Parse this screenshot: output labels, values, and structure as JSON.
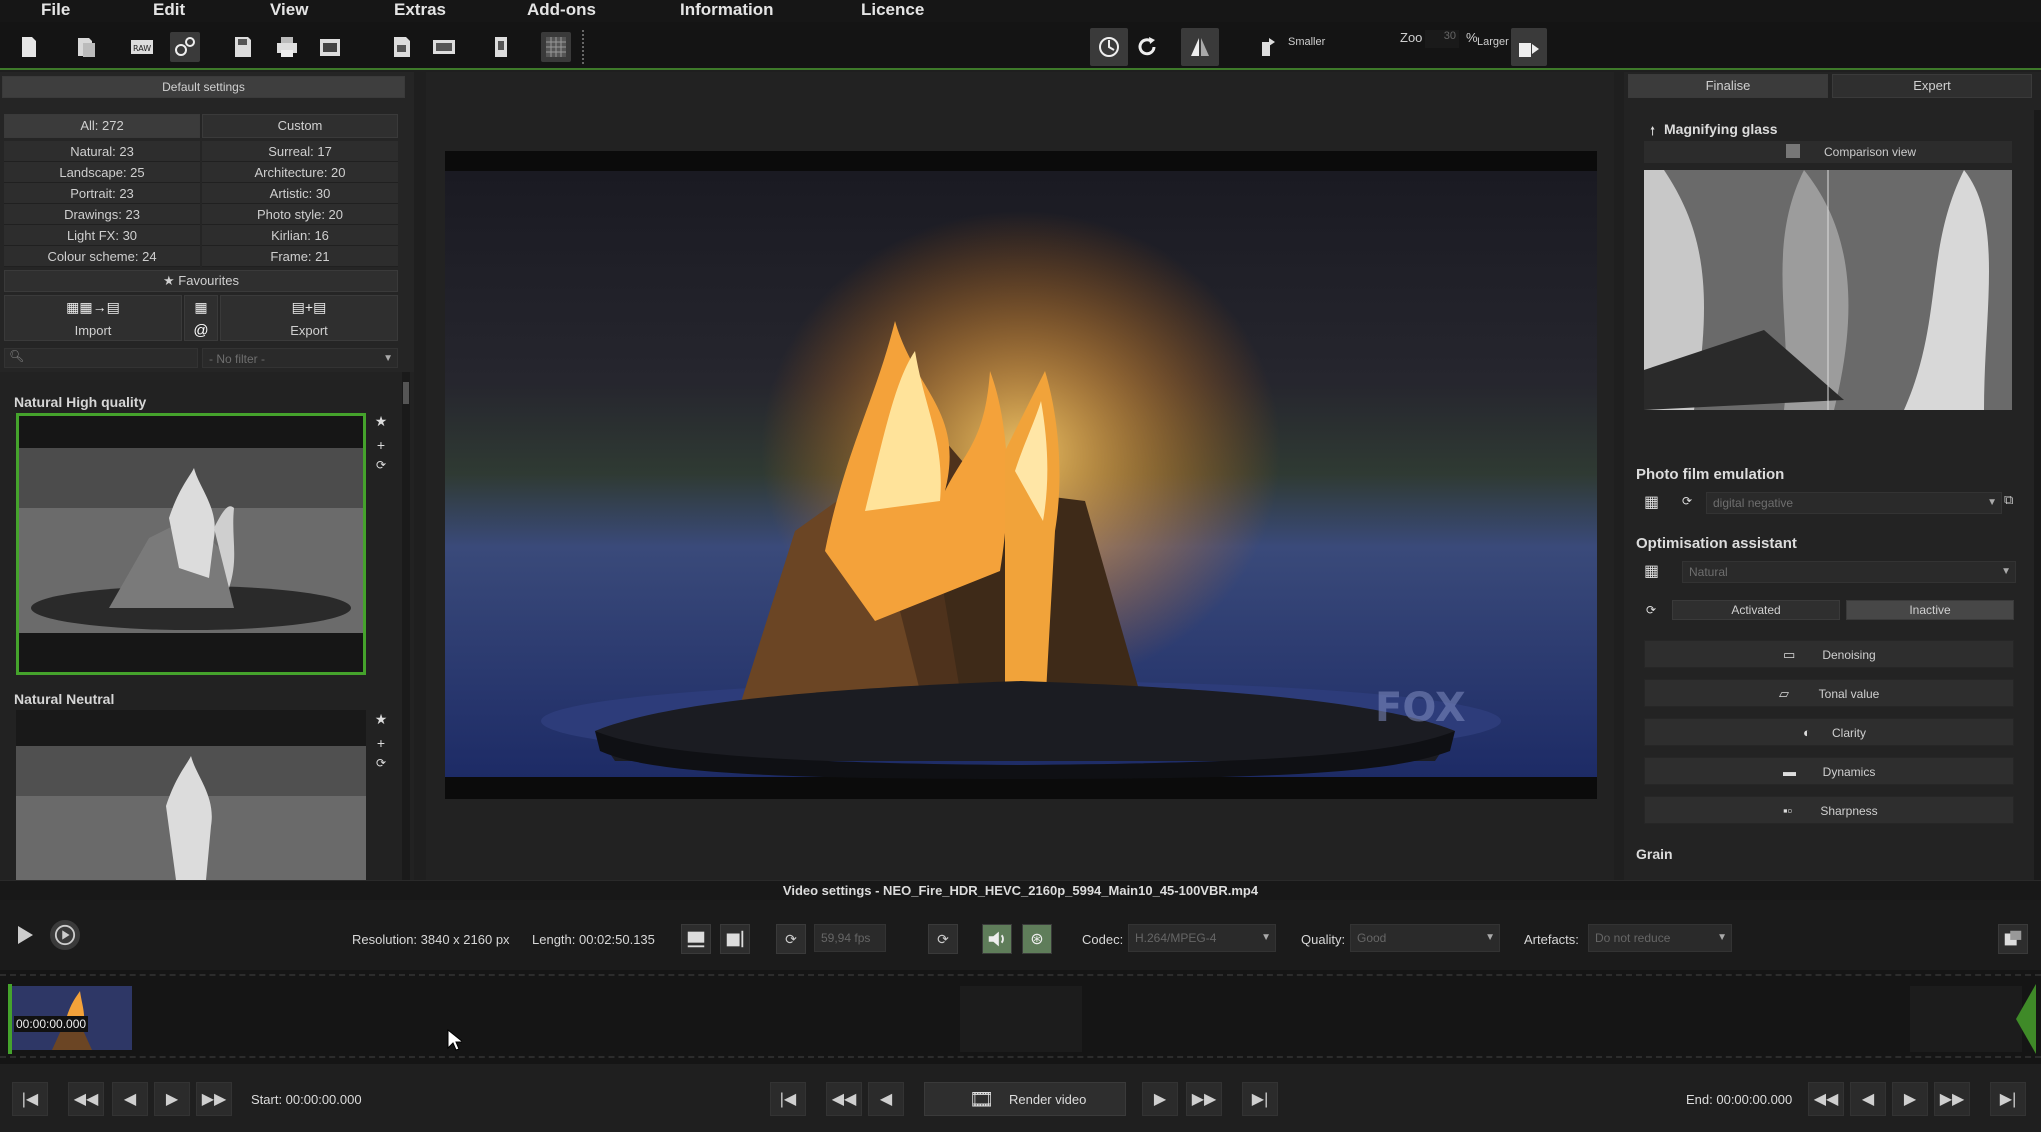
{
  "menu": {
    "file": "File",
    "edit": "Edit",
    "view": "View",
    "extras": "Extras",
    "addons": "Add-ons",
    "information": "Information",
    "licence": "Licence"
  },
  "toolbar": {
    "smaller": "Smaller",
    "zoom_label": "Zoo",
    "zoom_value": "30",
    "percent": "%",
    "larger": "Larger"
  },
  "left": {
    "preset_title": "Default settings",
    "all": "All: 272",
    "custom": "Custom",
    "categories": [
      [
        "Natural: 23",
        "Surreal: 17"
      ],
      [
        "Landscape: 25",
        "Architecture: 20"
      ],
      [
        "Portrait: 23",
        "Artistic: 30"
      ],
      [
        "Drawings: 23",
        "Photo style: 20"
      ],
      [
        "Light FX: 30",
        "Kirlian: 16"
      ],
      [
        "Colour scheme: 24",
        "Frame: 21"
      ]
    ],
    "favourites": "Favourites",
    "import": "Import",
    "export": "Export",
    "filter_placeholder": "- No filter -",
    "presets": [
      {
        "title": "Natural High quality"
      },
      {
        "title": "Natural Neutral"
      }
    ]
  },
  "right": {
    "tab_finalise": "Finalise",
    "tab_expert": "Expert",
    "magnifier": "Magnifying glass",
    "comparison": "Comparison view",
    "film_title": "Photo film emulation",
    "film_value": "digital negative",
    "opt_title": "Optimisation assistant",
    "opt_value": "Natural",
    "activated": "Activated",
    "inactive": "Inactive",
    "tools": [
      "Denoising",
      "Tonal value",
      "Clarity",
      "Dynamics",
      "Sharpness"
    ],
    "grain": "Grain"
  },
  "video": {
    "title": "Video settings - NEO_Fire_HDR_HEVC_2160p_5994_Main10_45-100VBR.mp4",
    "resolution": "Resolution: 3840 x 2160 px",
    "length": "Length: 00:02:50.135",
    "fps": "59,94 fps",
    "codec_label": "Codec:",
    "codec_value": "H.264/MPEG-4",
    "quality_label": "Quality:",
    "quality_value": "Good",
    "artefacts_label": "Artefacts:",
    "artefacts_value": "Do not reduce"
  },
  "timeline": {
    "timestamp": "00:00:00.000"
  },
  "transport": {
    "start": "Start: 00:00:00.000",
    "render": "Render video",
    "end": "End: 00:00:00.000"
  },
  "colors": {
    "accent_green": "#45a32c",
    "bg": "#1f1f1f"
  }
}
